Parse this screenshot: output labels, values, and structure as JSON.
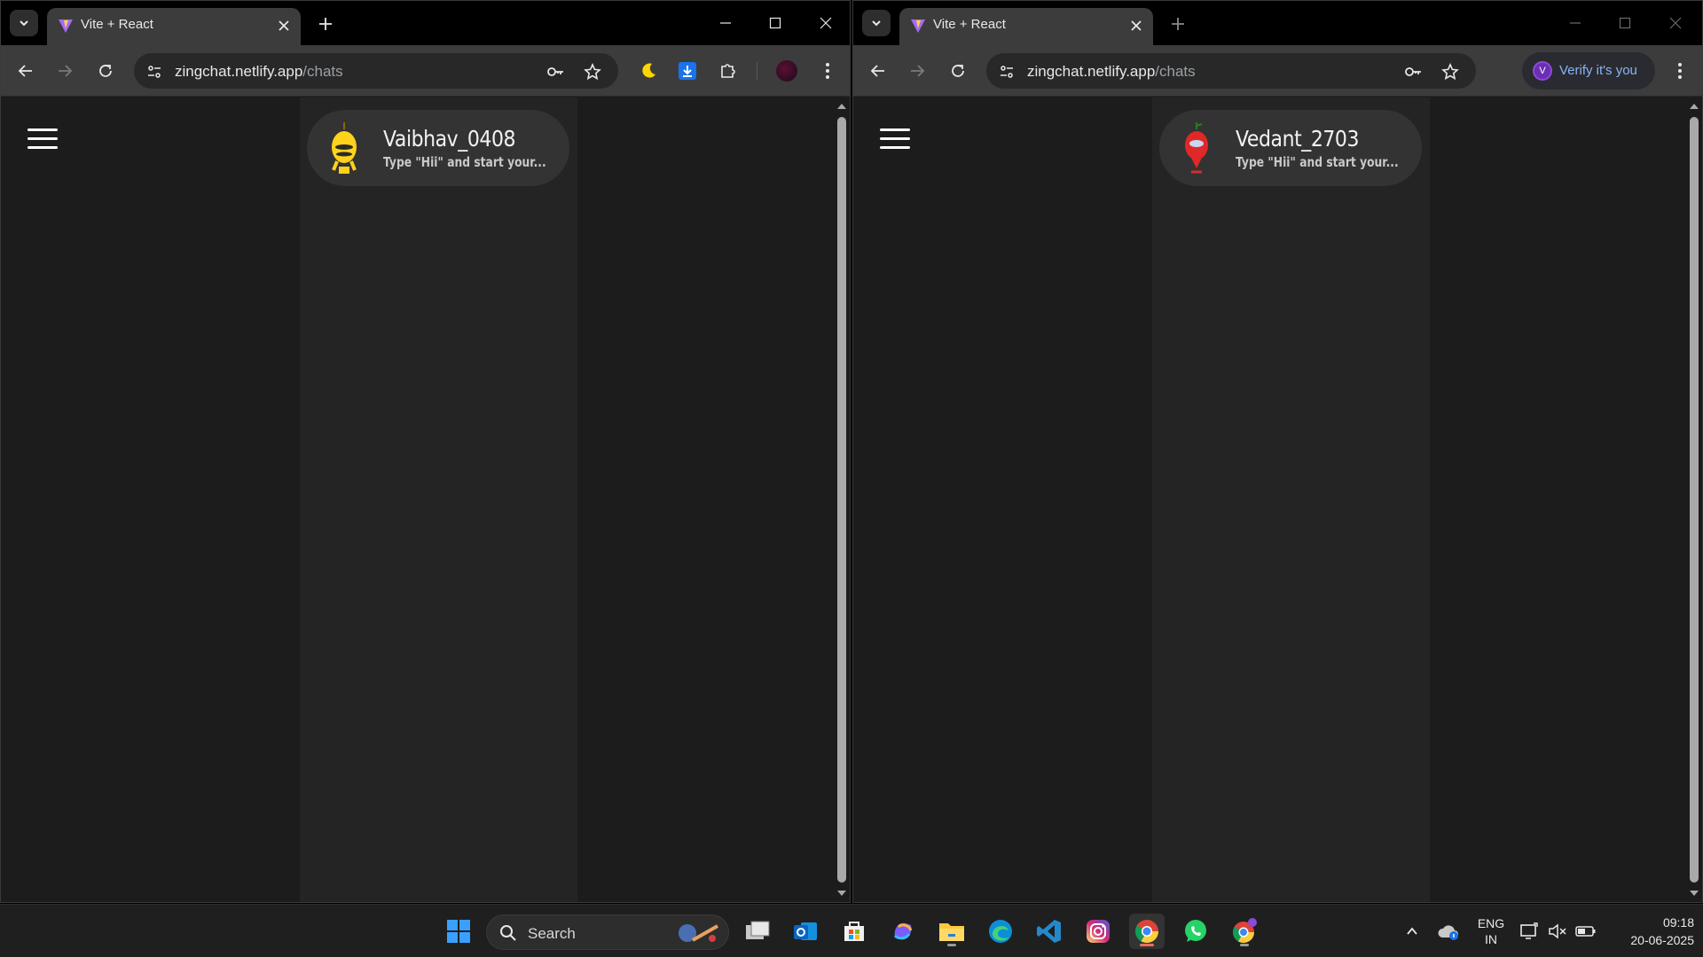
{
  "left_window": {
    "tab_title": "Vite + React",
    "url_host": "zingchat.netlify.app",
    "url_path": "/chats",
    "chat": {
      "name": "Vaibhav_0408",
      "preview": "Type \"Hii\" and start your..."
    }
  },
  "right_window": {
    "tab_title": "Vite + React",
    "url_host": "zingchat.netlify.app",
    "url_path": "/chats",
    "verify_label": "Verify it's you",
    "verify_avatar_letter": "V",
    "chat": {
      "name": "Vedant_2703",
      "preview": "Type \"Hii\" and start your..."
    }
  },
  "taskbar": {
    "search_label": "Search",
    "language_line1": "ENG",
    "language_line2": "IN",
    "time": "09:18",
    "date": "20-06-2025",
    "pinned_apps": [
      "start-icon",
      "search",
      "task-view-icon",
      "outlook-icon",
      "microsoft-store-icon",
      "copilot-icon",
      "file-explorer-icon",
      "edge-icon",
      "vscode-icon",
      "instagram-icon",
      "chrome-icon",
      "whatsapp-icon",
      "chrome-profile-icon"
    ]
  },
  "colors": {
    "background": "#1c1c1c",
    "chat_list_bg": "#242424",
    "chat_card_bg": "#333333",
    "toolbar": "#3c3c3c",
    "link_blue": "#8ab4f8"
  }
}
